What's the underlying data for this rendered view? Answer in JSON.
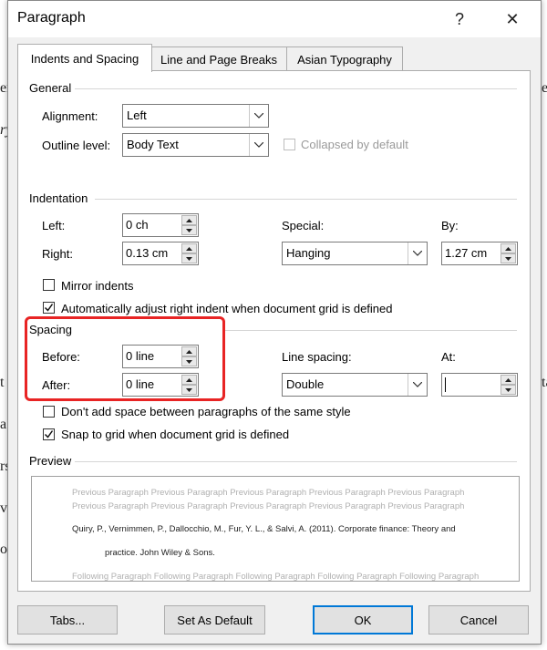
{
  "background": {
    "fragments": [
      "er",
      "ry",
      "t",
      "ti",
      "a",
      "rs",
      "v",
      "o",
      "e",
      "ta",
      "t"
    ]
  },
  "dialog": {
    "title": "Paragraph",
    "help_label": "?",
    "close_label": "✕",
    "tabs": [
      {
        "label": "Indents and Spacing",
        "active": true
      },
      {
        "label": "Line and Page Breaks",
        "active": false
      },
      {
        "label": "Asian Typography",
        "active": false
      }
    ],
    "general": {
      "label": "General",
      "alignment_label": "Alignment:",
      "alignment_value": "Left",
      "outline_label": "Outline level:",
      "outline_value": "Body Text",
      "collapsed_label": "Collapsed by default"
    },
    "indentation": {
      "label": "Indentation",
      "left_label": "Left:",
      "left_value": "0 ch",
      "right_label": "Right:",
      "right_value": "0.13 cm",
      "special_label": "Special:",
      "special_value": "Hanging",
      "by_label": "By:",
      "by_value": "1.27 cm",
      "mirror_label": "Mirror indents",
      "mirror_checked": false,
      "auto_adjust_label": "Automatically adjust right indent when document grid is defined",
      "auto_adjust_checked": true
    },
    "spacing": {
      "label": "Spacing",
      "before_label": "Before:",
      "before_value": "0 line",
      "after_label": "After:",
      "after_value": "0 line",
      "line_spacing_label": "Line spacing:",
      "line_spacing_value": "Double",
      "at_label": "At:",
      "at_value": "",
      "dont_add_label": "Don't add space between paragraphs of the same style",
      "dont_add_checked": false,
      "snap_label": "Snap to grid when document grid is defined",
      "snap_checked": true
    },
    "preview": {
      "label": "Preview",
      "prev_line1": "Previous Paragraph Previous Paragraph Previous Paragraph Previous Paragraph Previous Paragraph",
      "prev_line2": "Previous Paragraph Previous Paragraph Previous Paragraph Previous Paragraph Previous Paragraph",
      "sample_line1": "Quiry, P., Vernimmen, P., Dallocchio, M., Fur, Y. L., & Salvi, A. (2011). Corporate finance: Theory and",
      "sample_line2": "practice. John Wiley & Sons.",
      "following_line": "Following Paragraph Following Paragraph Following Paragraph Following Paragraph Following Paragraph"
    },
    "buttons": {
      "tabs": "Tabs...",
      "set_default": "Set As Default",
      "ok": "OK",
      "cancel": "Cancel"
    },
    "colors": {
      "accent": "#0078d7",
      "highlight": "#e82424"
    }
  }
}
